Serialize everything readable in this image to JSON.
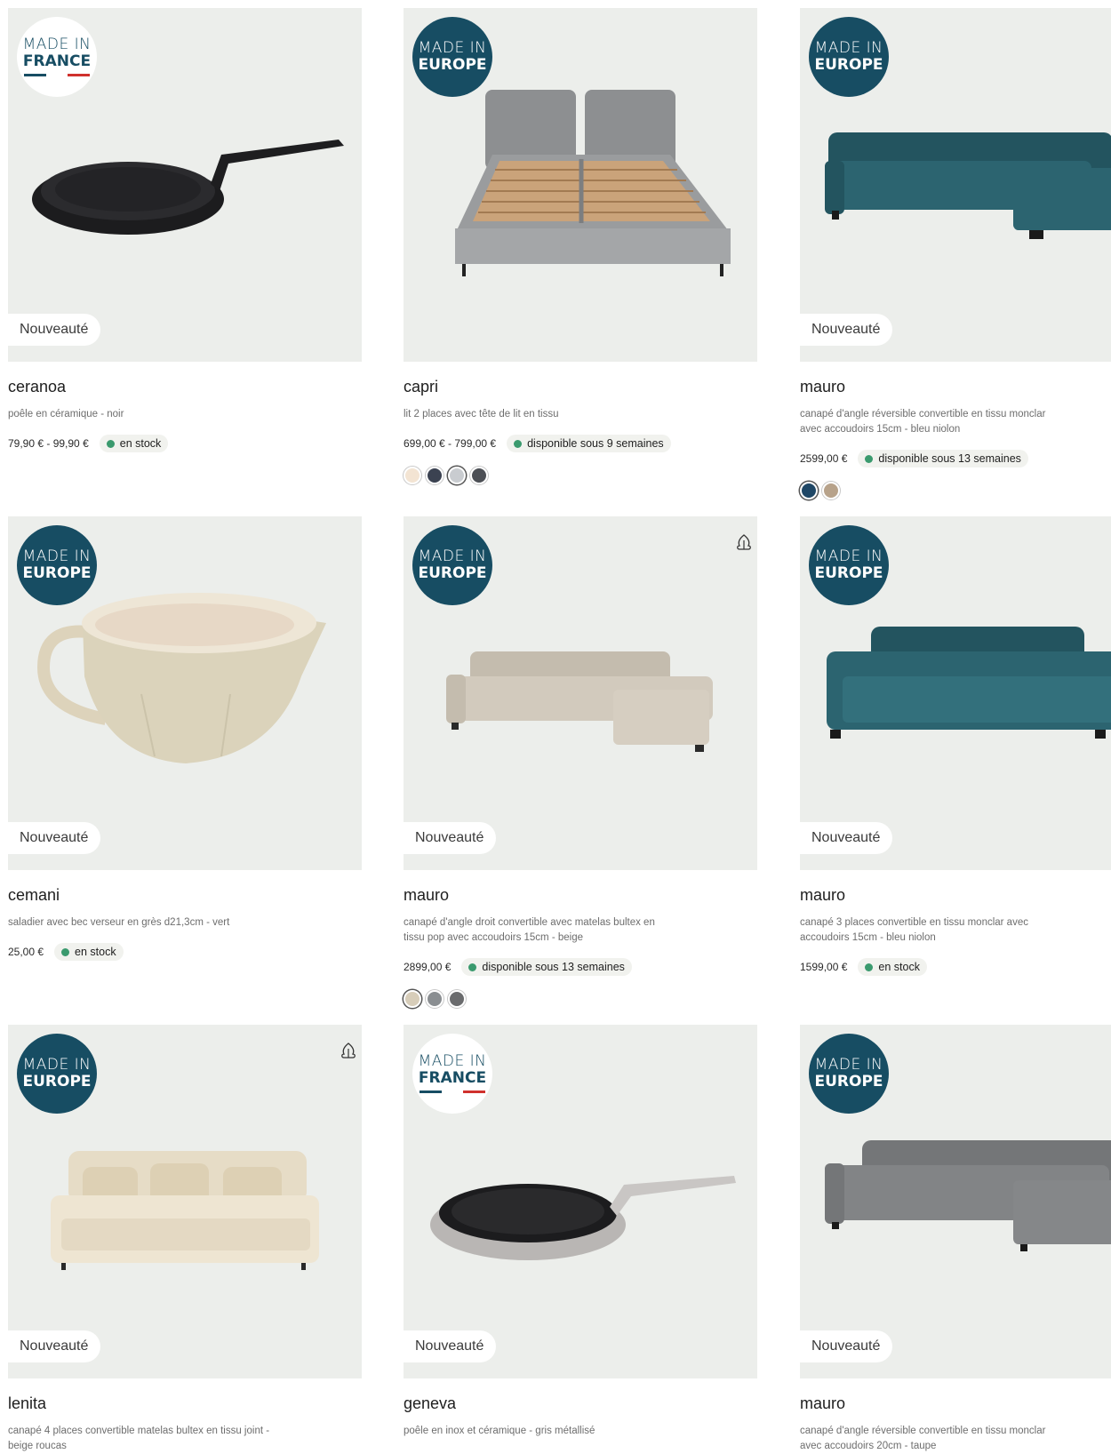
{
  "colors": {
    "card_bg": "#eceeeb",
    "badge_europe": "#174d63",
    "stock_dot": "#3a9a6e",
    "flag_blue": "#174d63",
    "flag_white": "#ffffff",
    "flag_red": "#d0312d"
  },
  "labels": {
    "new": "Nouveauté",
    "made_in": "MADE IN",
    "europe": "EUROPE",
    "france": "FRANCE",
    "fsc": "FSC"
  },
  "products": [
    {
      "name": "ceranoa",
      "desc": "poêle en céramique - noir",
      "price": "79,90 € - 99,90 €",
      "stock": "en stock",
      "badge": "france",
      "is_new": true,
      "image": "pan-black-icon"
    },
    {
      "name": "capri",
      "desc": "lit 2 places avec tête de lit en tissu",
      "price": "699,00 € - 799,00 €",
      "stock": "disponible sous 9 semaines",
      "badge": "europe",
      "is_new": false,
      "image": "bed-icon",
      "swatches": [
        "#f3e4d3",
        "#3b4251",
        "#c9ccd0",
        "#4c4f55"
      ],
      "selected_swatch": 2
    },
    {
      "name": "mauro",
      "desc": "canapé d'angle réversible convertible en tissu monclar avec accoudoirs 15cm - bleu niolon",
      "price": "2599,00 €",
      "stock": "disponible sous 13 semaines",
      "badge": "europe",
      "is_new": true,
      "image": "corner-sofa-blue-icon",
      "swatches": [
        "#1f4766",
        "#b7a28a"
      ],
      "selected_swatch": 0
    },
    {
      "name": "cemani",
      "desc": "saladier avec bec verseur en grès d21,3cm - vert",
      "price": "25,00 €",
      "stock": "en stock",
      "badge": "europe",
      "is_new": true,
      "image": "bowl-icon"
    },
    {
      "name": "mauro",
      "desc": "canapé d'angle droit convertible avec matelas bultex en tissu pop avec accoudoirs 15cm - beige",
      "price": "2899,00 €",
      "stock": "disponible sous 13 semaines",
      "badge": "europe",
      "is_new": true,
      "fsc": true,
      "image": "corner-sofa-beige-icon",
      "swatches": [
        "#d7cdb9",
        "#8a8e91",
        "#6a6b6d"
      ],
      "selected_swatch": 0
    },
    {
      "name": "mauro",
      "desc": "canapé 3 places convertible en tissu monclar avec accoudoirs 15cm - bleu niolon",
      "price": "1599,00 €",
      "stock": "en stock",
      "badge": "europe",
      "is_new": true,
      "image": "sofa-blue-icon"
    },
    {
      "name": "lenita",
      "desc": "canapé 4 places convertible matelas bultex en tissu joint - beige roucas",
      "badge": "europe",
      "is_new": true,
      "fsc": true,
      "image": "sofa-cream-icon"
    },
    {
      "name": "geneva",
      "desc": "poêle en inox et céramique - gris métallisé",
      "badge": "france",
      "is_new": true,
      "image": "pan-steel-icon"
    },
    {
      "name": "mauro",
      "desc": "canapé d'angle réversible convertible en tissu monclar avec accoudoirs 20cm - taupe",
      "badge": "europe",
      "is_new": true,
      "image": "corner-sofa-grey-icon"
    }
  ]
}
